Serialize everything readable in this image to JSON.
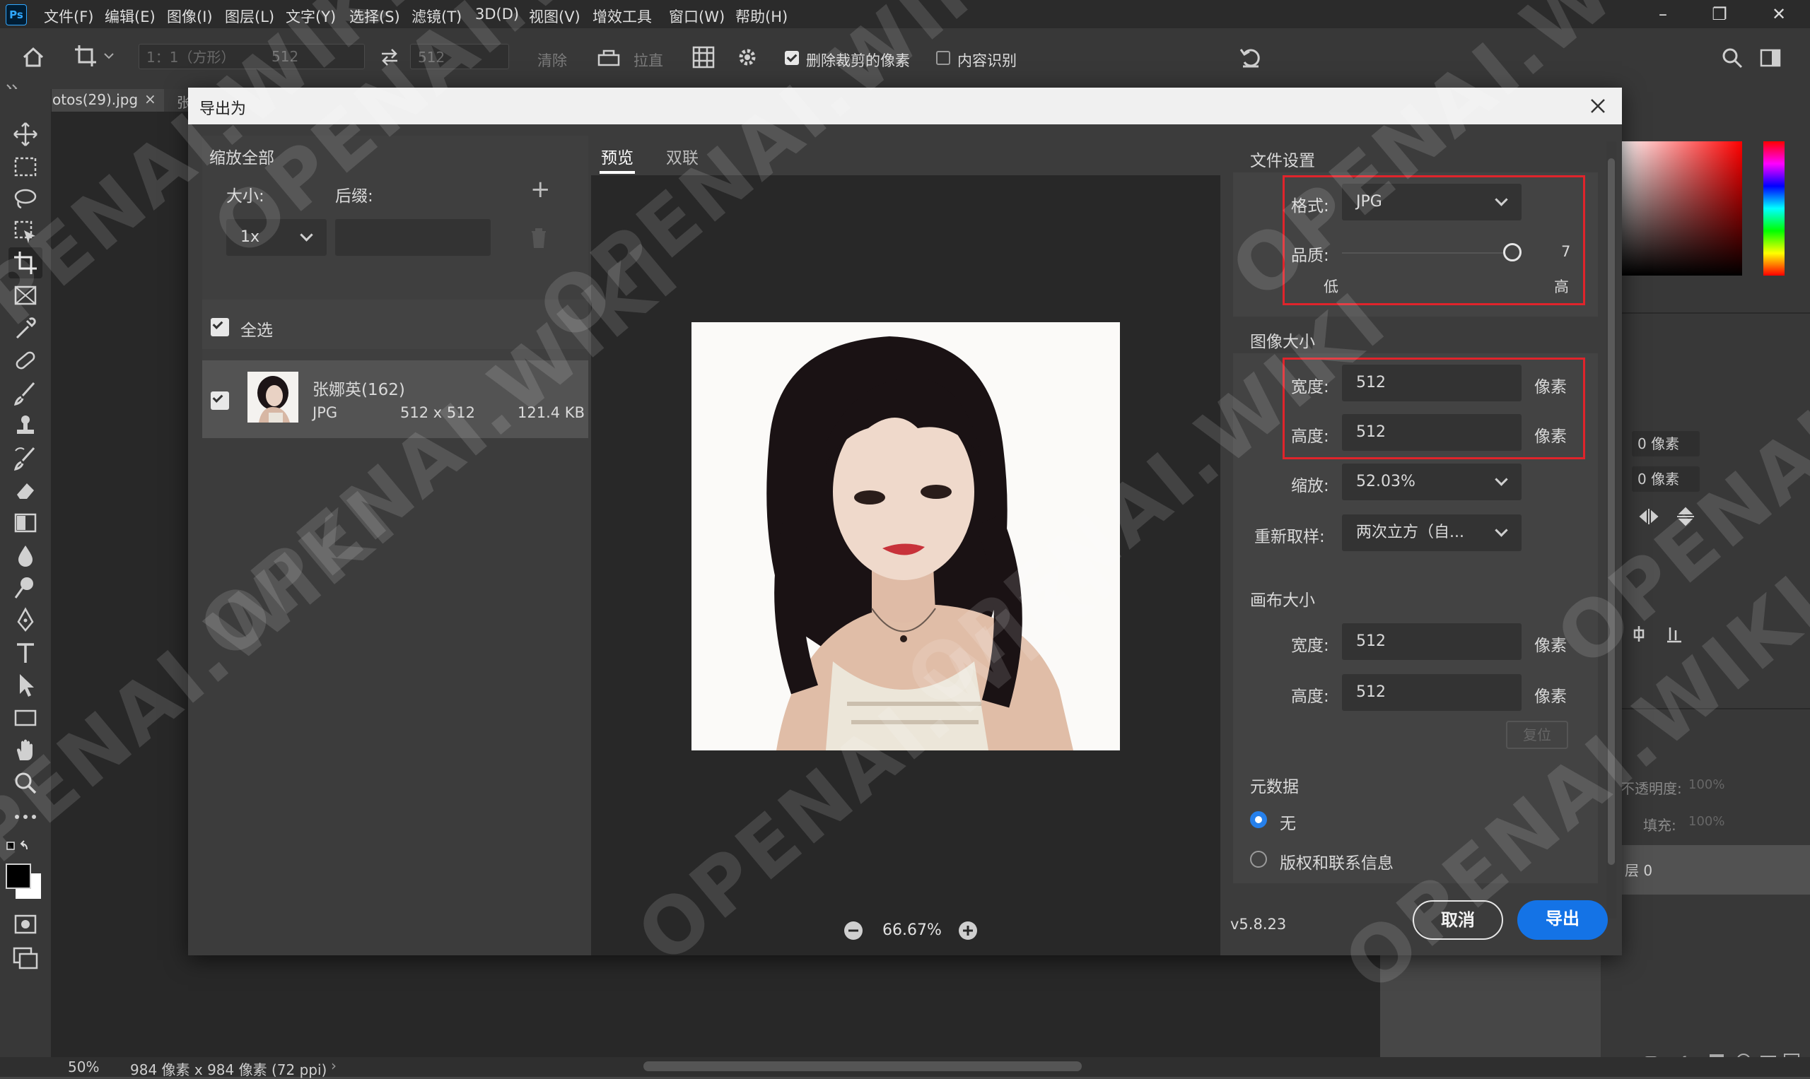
{
  "app": {
    "logo": "Ps"
  },
  "menu": [
    "文件(F)",
    "编辑(E)",
    "图像(I)",
    "图层(L)",
    "文字(Y)",
    "选择(S)",
    "滤镜(T)",
    "3D(D)",
    "视图(V)",
    "增效工具",
    "窗口(W)",
    "帮助(H)"
  ],
  "options_bar": {
    "ratio": "1：1（方形）",
    "width": "512",
    "height": "512",
    "clear": "清除",
    "straighten": "拉直",
    "delete_cropped": "删除裁剪的像素",
    "content_aware": "内容识别"
  },
  "doc_tab": {
    "name": "otos(29).jpg",
    "close": "×",
    "next": "张"
  },
  "dialog": {
    "title": "导出为",
    "scale_all": {
      "heading": "缩放全部",
      "size_label": "大小:",
      "suffix_label": "后缀:",
      "size_value": "1x",
      "suffix_value": ""
    },
    "select_all": "全选",
    "asset": {
      "name": "张娜英(162)",
      "format": "JPG",
      "dimensions": "512 x 512",
      "filesize": "121.4 KB"
    },
    "tabs": [
      "预览",
      "双联"
    ],
    "zoom": "66.67%",
    "file_settings": {
      "heading": "文件设置",
      "format_label": "格式:",
      "format_value": "JPG",
      "quality_label": "品质:",
      "quality_value": "7",
      "quality_low": "低",
      "quality_high": "高"
    },
    "image_size": {
      "heading": "图像大小",
      "width_label": "宽度:",
      "width_value": "512",
      "height_label": "高度:",
      "height_value": "512",
      "unit": "像素",
      "scale_label": "缩放:",
      "scale_value": "52.03%",
      "resample_label": "重新取样:",
      "resample_value": "两次立方（自..."
    },
    "canvas_size": {
      "heading": "画布大小",
      "width_label": "宽度:",
      "width_value": "512",
      "height_label": "高度:",
      "height_value": "512",
      "unit": "像素",
      "reset": "复位"
    },
    "metadata": {
      "heading": "元数据",
      "option_none": "无",
      "option_copyright": "版权和联系信息"
    },
    "version": "v5.8.23",
    "cancel": "取消",
    "export": "导出"
  },
  "right_panel": {
    "offset1": "0 像素",
    "offset2": "0 像素",
    "opacity": "不透明度:",
    "opacity_val": "100%",
    "fill": "填充:",
    "fill_val": "100%",
    "layer": "层 0"
  },
  "status": {
    "zoom": "50%",
    "doc_info": "984 像素 x 984 像素 (72 ppi)"
  },
  "watermark": "OPENAI.WIKI"
}
